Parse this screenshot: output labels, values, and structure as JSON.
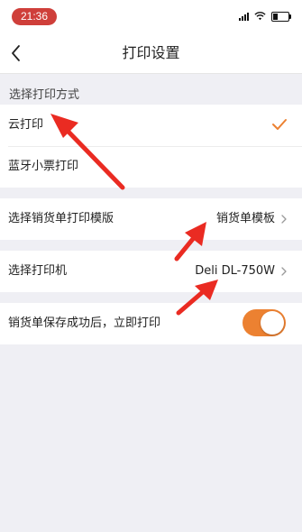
{
  "status_bar": {
    "time": "21:36",
    "time_pill_color": "#cf3f3a"
  },
  "nav": {
    "title": "打印设置",
    "back_icon": "chevron-left-icon"
  },
  "print_method": {
    "section_label": "选择打印方式",
    "options": [
      {
        "label": "云打印",
        "selected": true
      },
      {
        "label": "蓝牙小票打印",
        "selected": false
      }
    ],
    "check_color": "#ec8131"
  },
  "template_row": {
    "label": "选择销货单打印模版",
    "value": "销货单模板"
  },
  "printer_row": {
    "label": "选择打印机",
    "value": "Deli DL-750W"
  },
  "auto_print": {
    "label": "销货单保存成功后，立即打印",
    "enabled": true,
    "toggle_color": "#ec8131"
  },
  "annotation_arrow_color": "#ea2b22"
}
